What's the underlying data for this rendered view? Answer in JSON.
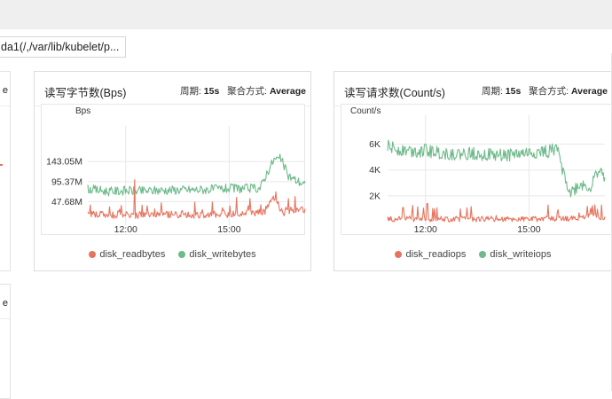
{
  "filter": {
    "value": "da1(/,/var/lib/kubelet/p..."
  },
  "left_cut_cards": [
    {
      "text": "e"
    },
    {
      "text": "e"
    }
  ],
  "cards": [
    {
      "title": "读写字节数(Bps)",
      "period_label": "周期:",
      "period_value": "15s",
      "agg_label": "聚合方式:",
      "agg_value": "Average",
      "legend": [
        {
          "label": "disk_readbytes"
        },
        {
          "label": "disk_writebytes"
        }
      ]
    },
    {
      "title": "读写请求数(Count/s)",
      "period_label": "周期:",
      "period_value": "15s",
      "agg_label": "聚合方式:",
      "agg_value": "Average",
      "legend": [
        {
          "label": "disk_readiops"
        },
        {
          "label": "disk_writeiops"
        }
      ]
    }
  ],
  "colors": {
    "read": "#e8735d",
    "write": "#6dba8a",
    "grid": "#e8e8e8",
    "axis_text": "#333333"
  },
  "chart_data": [
    {
      "type": "line",
      "title": "读写字节数(Bps)",
      "ylabel": "Bps",
      "x_ticks": [
        "12:00",
        "15:00"
      ],
      "y_ticks": [
        "47.68M",
        "95.37M",
        "143.05M"
      ],
      "y_tick_values": [
        47.68,
        95.37,
        143.05
      ],
      "ylim": [
        0,
        190
      ],
      "x_range_hours": [
        10.9,
        17.2
      ],
      "x_tick_hours": [
        12,
        15
      ],
      "series": [
        {
          "name": "disk_readbytes",
          "color": "#e8735d",
          "x": [
            10.9,
            11.5,
            12.1,
            12.3,
            12.7,
            13.2,
            13.6,
            14.1,
            14.6,
            15.1,
            15.6,
            16.0,
            16.3,
            16.6,
            16.8,
            17.2
          ],
          "y": [
            20,
            16,
            18,
            15,
            19,
            17,
            18,
            16,
            19,
            18,
            20,
            22,
            55,
            18,
            30,
            26
          ]
        },
        {
          "name": "disk_writebytes",
          "color": "#6dba8a",
          "x": [
            10.9,
            11.5,
            12.0,
            12.5,
            13.0,
            13.5,
            14.0,
            14.5,
            15.0,
            15.5,
            15.9,
            16.1,
            16.3,
            16.5,
            16.7,
            16.9,
            17.2
          ],
          "y": [
            78,
            72,
            74,
            73,
            75,
            76,
            76,
            77,
            79,
            79,
            80,
            118,
            148,
            150,
            110,
            100,
            88
          ]
        }
      ]
    },
    {
      "type": "line",
      "title": "读写请求数(Count/s)",
      "ylabel": "Count/s",
      "x_ticks": [
        "12:00",
        "15:00"
      ],
      "y_ticks": [
        "2K",
        "4K",
        "6K"
      ],
      "y_tick_values": [
        2000,
        4000,
        6000
      ],
      "ylim": [
        0,
        7000
      ],
      "x_range_hours": [
        10.9,
        17.2
      ],
      "x_tick_hours": [
        12,
        15
      ],
      "series": [
        {
          "name": "disk_readiops",
          "color": "#e8735d",
          "x": [
            10.9,
            11.5,
            12.0,
            12.5,
            13.0,
            13.5,
            14.0,
            14.5,
            15.0,
            15.5,
            16.0,
            16.5,
            16.8,
            17.2
          ],
          "y": [
            200,
            250,
            180,
            210,
            200,
            190,
            230,
            200,
            220,
            210,
            200,
            300,
            500,
            250
          ]
        },
        {
          "name": "disk_writeiops",
          "color": "#6dba8a",
          "x": [
            10.9,
            11.2,
            11.6,
            12.0,
            12.5,
            13.0,
            13.5,
            14.0,
            14.5,
            15.0,
            15.5,
            15.8,
            16.0,
            16.2,
            16.5,
            16.8,
            17.0,
            17.2
          ],
          "y": [
            5800,
            5600,
            5500,
            5500,
            5300,
            5200,
            5300,
            5100,
            5200,
            5300,
            5400,
            5700,
            3800,
            2200,
            2900,
            2600,
            4000,
            3400
          ]
        }
      ]
    }
  ]
}
